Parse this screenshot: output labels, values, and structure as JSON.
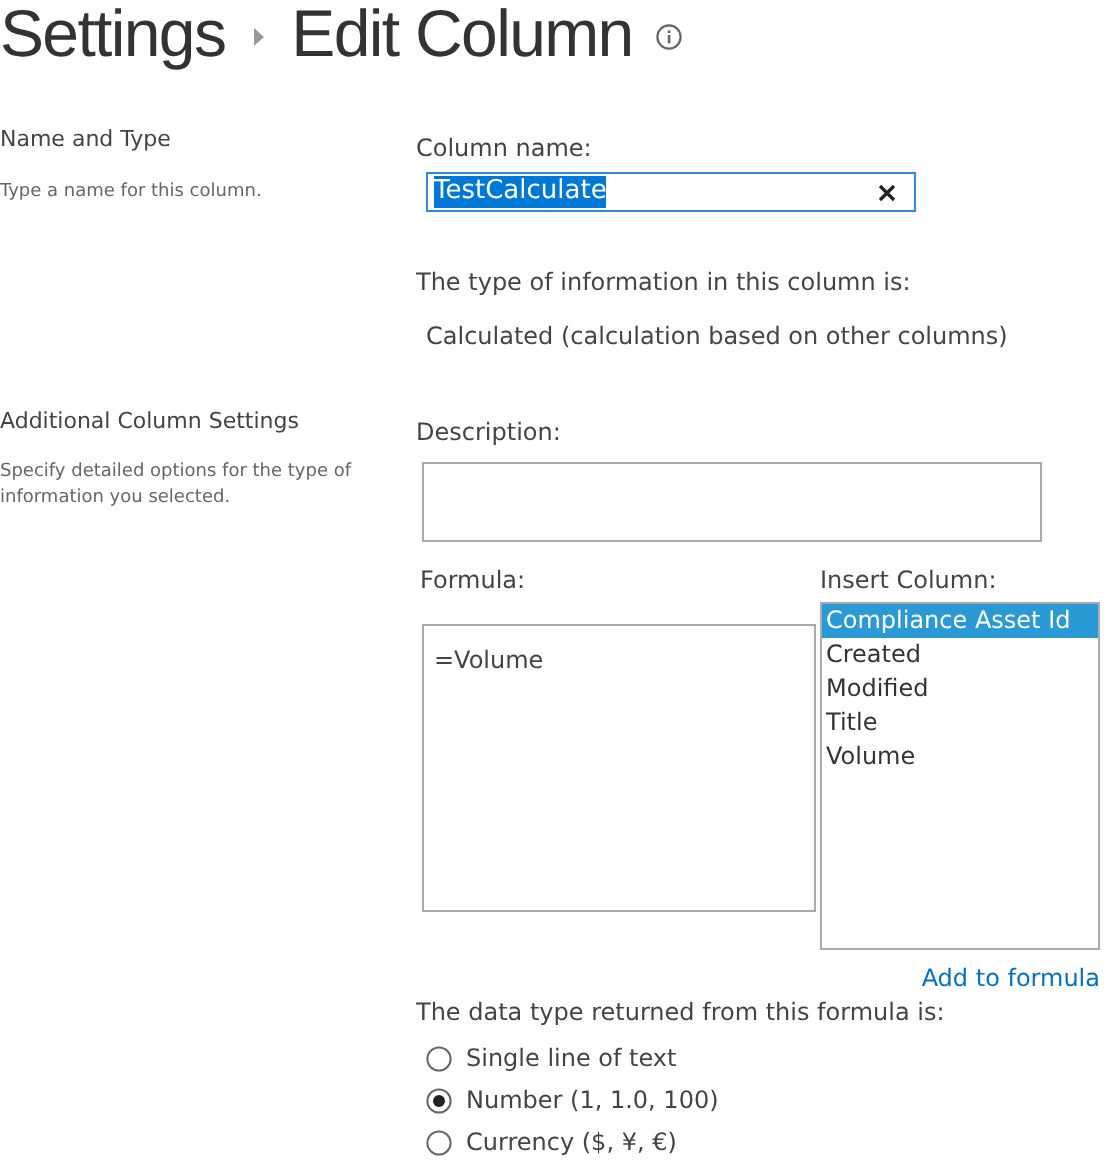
{
  "breadcrumb": [
    "Settings",
    "Edit Column"
  ],
  "sections": [
    {
      "title": "Name and Type",
      "description": "Type a name for this column."
    },
    {
      "title": "Additional Column Settings",
      "description": "Specify detailed options for the type of information you selected."
    }
  ],
  "column_name": {
    "label": "Column name:",
    "value": "TestCalculate",
    "text_selected": true
  },
  "type_info": {
    "label": "The type of information in this column is:",
    "value": "Calculated (calculation based on other columns)"
  },
  "description": {
    "label": "Description:"
  },
  "formula": {
    "label": "Formula:",
    "value": "=Volume"
  },
  "insert_column": {
    "label": "Insert Column:",
    "items": [
      {
        "label": "Compliance Asset Id",
        "selected": true
      },
      {
        "label": "Created",
        "selected": false
      },
      {
        "label": "Modified",
        "selected": false
      },
      {
        "label": "Title",
        "selected": false
      },
      {
        "label": "Volume",
        "selected": false
      }
    ],
    "link": "Add to formula"
  },
  "data_type": {
    "label": "The data type returned from this formula is:",
    "options": [
      {
        "label": "Single line of text",
        "selected": false
      },
      {
        "label": "Number (1, 1.0, 100)",
        "selected": true
      },
      {
        "label": "Currency ($, ¥, €)",
        "selected": false
      }
    ]
  }
}
